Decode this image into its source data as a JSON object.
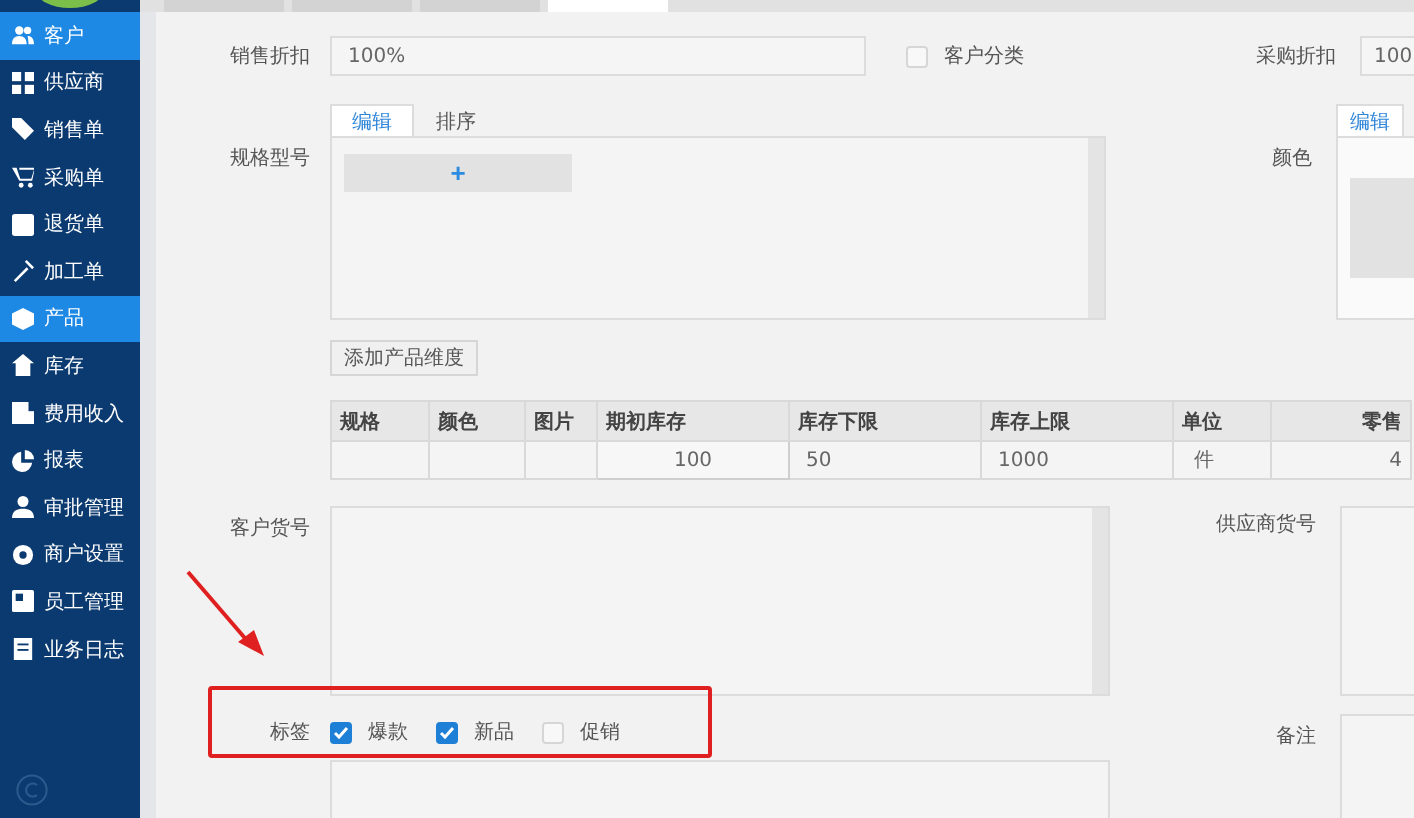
{
  "sidebar": {
    "items": [
      {
        "label": "客户",
        "selected": true
      },
      {
        "label": "供应商",
        "selected": false
      },
      {
        "label": "销售单",
        "selected": false
      },
      {
        "label": "采购单",
        "selected": false
      },
      {
        "label": "退货单",
        "selected": false
      },
      {
        "label": "加工单",
        "selected": false
      },
      {
        "label": "产品",
        "selected": true
      },
      {
        "label": "库存",
        "selected": false
      },
      {
        "label": "费用收入",
        "selected": false
      },
      {
        "label": "报表",
        "selected": false
      },
      {
        "label": "审批管理",
        "selected": false
      },
      {
        "label": "商户设置",
        "selected": false
      },
      {
        "label": "员工管理",
        "selected": false
      },
      {
        "label": "业务日志",
        "selected": false
      }
    ]
  },
  "form": {
    "sales_discount": {
      "label": "销售折扣",
      "value": "100%"
    },
    "customer_category": {
      "label": "客户分类",
      "checked": false
    },
    "purchase_discount": {
      "label": "采购折扣",
      "value": "100"
    },
    "spec_model": {
      "label": "规格型号",
      "tabs": [
        {
          "label": "编辑",
          "selected": true
        },
        {
          "label": "排序",
          "selected": false
        }
      ],
      "add_button": "+"
    },
    "color": {
      "label": "颜色",
      "tabs": [
        {
          "label": "编辑",
          "selected": true
        }
      ]
    },
    "add_dimension_button": "添加产品维度",
    "table": {
      "columns": [
        "规格",
        "颜色",
        "图片",
        "期初库存",
        "库存下限",
        "库存上限",
        "单位",
        "零售"
      ],
      "rows": [
        [
          "",
          "",
          "",
          "100",
          "50",
          "1000",
          "件",
          "4"
        ]
      ]
    },
    "customer_sku": {
      "label": "客户货号"
    },
    "supplier_sku": {
      "label": "供应商货号"
    },
    "tags": {
      "label": "标签",
      "options": [
        {
          "label": "爆款",
          "checked": true
        },
        {
          "label": "新品",
          "checked": true
        },
        {
          "label": "促销",
          "checked": false
        }
      ]
    },
    "remarks": {
      "label": "备注"
    }
  }
}
